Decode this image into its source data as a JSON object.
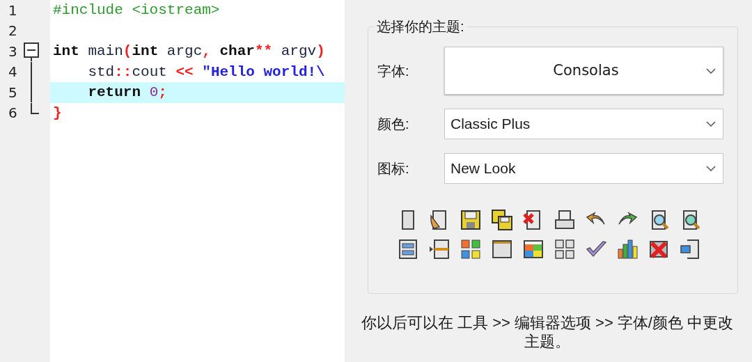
{
  "editor": {
    "lines": [
      {
        "number": "1",
        "highlighted": false,
        "tokens": [
          {
            "kind": "pre",
            "text": "#include <iostream>"
          }
        ]
      },
      {
        "number": "2",
        "highlighted": false
      },
      {
        "number": "3",
        "highlighted": false,
        "expanded": true,
        "tokens": [
          {
            "kind": "kw",
            "text": "int"
          },
          {
            "kind": "id",
            "text": " main"
          },
          {
            "kind": "sym",
            "text": "("
          },
          {
            "kind": "kw",
            "text": "int"
          },
          {
            "kind": "id",
            "text": " argc"
          },
          {
            "kind": "sym",
            "text": ","
          },
          {
            "kind": "kw",
            "text": " char"
          },
          {
            "kind": "sym",
            "text": "**"
          },
          {
            "kind": "id",
            "text": " argv"
          },
          {
            "kind": "sym",
            "text": ")"
          }
        ],
        "children": [
          {
            "number": "4",
            "highlighted": false,
            "tokens": [
              {
                "kind": "id",
                "text": "    std"
              },
              {
                "kind": "sym",
                "text": "::"
              },
              {
                "kind": "id",
                "text": "cout "
              },
              {
                "kind": "sym",
                "text": "<<"
              },
              {
                "kind": "str",
                "text": " \"Hello world!\\"
              }
            ]
          },
          {
            "number": "5",
            "highlighted": true,
            "tokens": [
              {
                "kind": "kw",
                "text": "    return "
              },
              {
                "kind": "num",
                "text": "0"
              },
              {
                "kind": "sym",
                "text": ";"
              }
            ]
          },
          {
            "number": "6",
            "highlighted": false,
            "tokens": [
              {
                "kind": "sym",
                "text": "}"
              }
            ]
          }
        ]
      }
    ]
  },
  "theme_group": {
    "title": "选择你的主题:",
    "fields": [
      {
        "kind": "font",
        "label": "字体:",
        "value": "Consolas"
      },
      {
        "kind": "color",
        "label": "颜色:",
        "value": "Classic Plus"
      },
      {
        "kind": "icons",
        "label": "图标:",
        "value": "New Look"
      }
    ]
  },
  "note": "你以后可以在 工具 >> 编辑器选项 >> 字体/颜色 中更改主题。"
}
